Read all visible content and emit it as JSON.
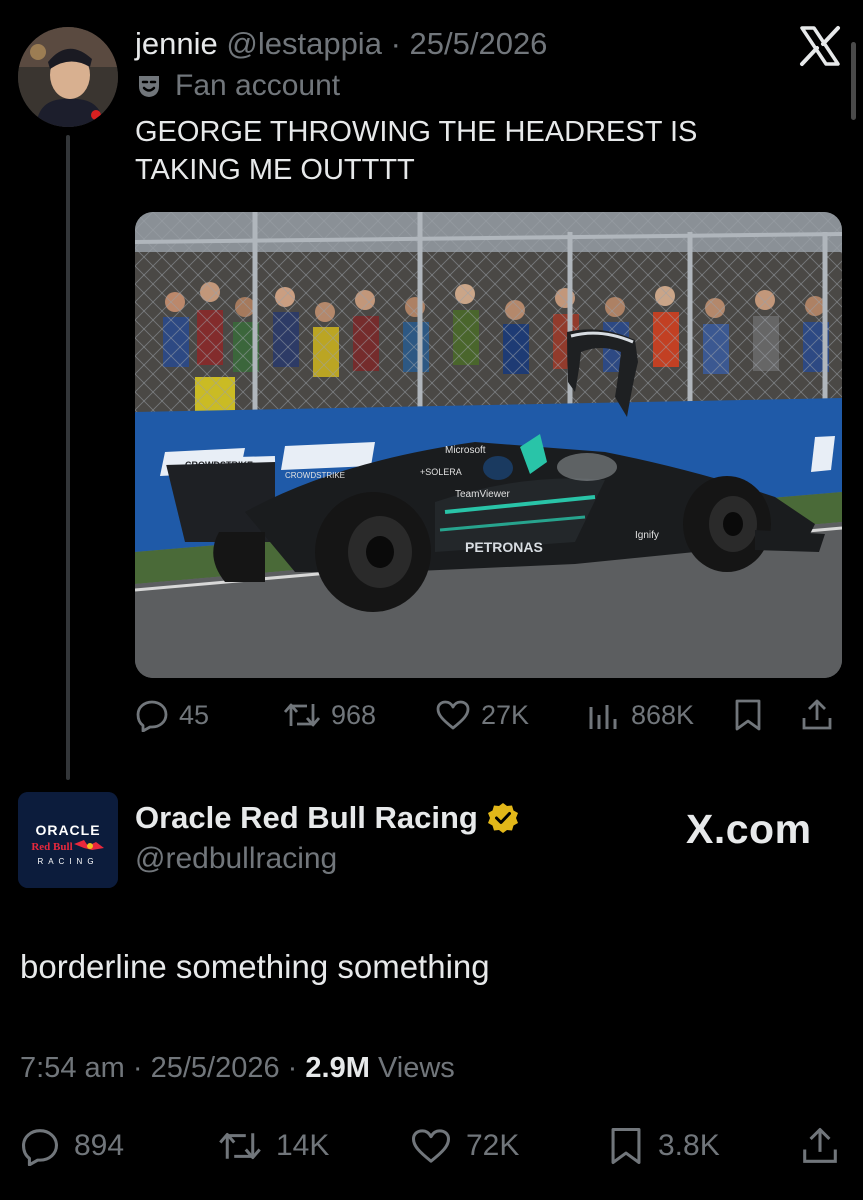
{
  "quoted_tweet": {
    "display_name": "jennie",
    "handle": "@lestappia",
    "separator": "·",
    "date": "25/5/2026",
    "label": "Fan account",
    "label_icon": "theater-masks-icon",
    "text_line1": "GEORGE THROWING THE HEADREST IS",
    "text_line2": "TAKING ME OUTTTT",
    "media_alt": "Mercedes F1 car with headrest flying off",
    "media_car_sponsors": [
      "Microsoft",
      "SOLERA",
      "TeamViewer",
      "PETRONAS",
      "CROWDSTRIKE",
      "Ignify"
    ],
    "stats": {
      "replies": "45",
      "reposts": "968",
      "likes": "27K",
      "views": "868K"
    }
  },
  "main_tweet": {
    "display_name": "Oracle Red Bull Racing",
    "verified_badge": "gold-verified-icon",
    "handle": "@redbullracing",
    "avatar_text": {
      "line1": "ORACLE",
      "line2": "Red Bull",
      "line3": "RACING"
    },
    "text": "borderline something something",
    "time": "7:54 am",
    "date": "25/5/2026",
    "separator": "·",
    "views_count": "2.9M",
    "views_label": "Views",
    "stats": {
      "replies": "894",
      "reposts": "14K",
      "likes": "72K",
      "bookmarks": "3.8K"
    }
  },
  "watermark": "X.com",
  "colors": {
    "background": "#000000",
    "text": "#e7e9ea",
    "secondary": "#71767b",
    "gold_badge": "#e2b719",
    "redbull_navy": "#0c1c3c"
  }
}
